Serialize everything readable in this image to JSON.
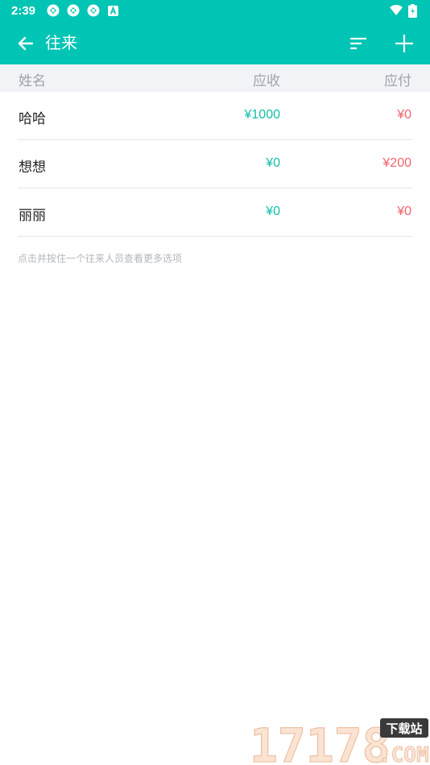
{
  "status_bar": {
    "time": "2:39",
    "icons": [
      "sync-icon",
      "sync-icon",
      "sync-icon",
      "a-icon",
      "wifi-icon",
      "battery-icon"
    ]
  },
  "app_bar": {
    "title": "往来",
    "back_icon": "arrow-left-icon",
    "sort_icon": "sort-icon",
    "add_icon": "plus-icon"
  },
  "table": {
    "headers": {
      "name": "姓名",
      "receivable": "应收",
      "payable": "应付"
    },
    "rows": [
      {
        "name": "哈哈",
        "receivable": "¥1000",
        "payable": "¥0"
      },
      {
        "name": "想想",
        "receivable": "¥0",
        "payable": "¥200"
      },
      {
        "name": "丽丽",
        "receivable": "¥0",
        "payable": "¥0"
      }
    ]
  },
  "hint": "点击并按住一个往来人员查看更多选项",
  "watermark": {
    "number": "17178",
    "badge": "下载站",
    "domain": ".COM"
  },
  "colors": {
    "primary": "#00c4b4",
    "receivable": "#13bfa9",
    "payable": "#f2636d"
  }
}
